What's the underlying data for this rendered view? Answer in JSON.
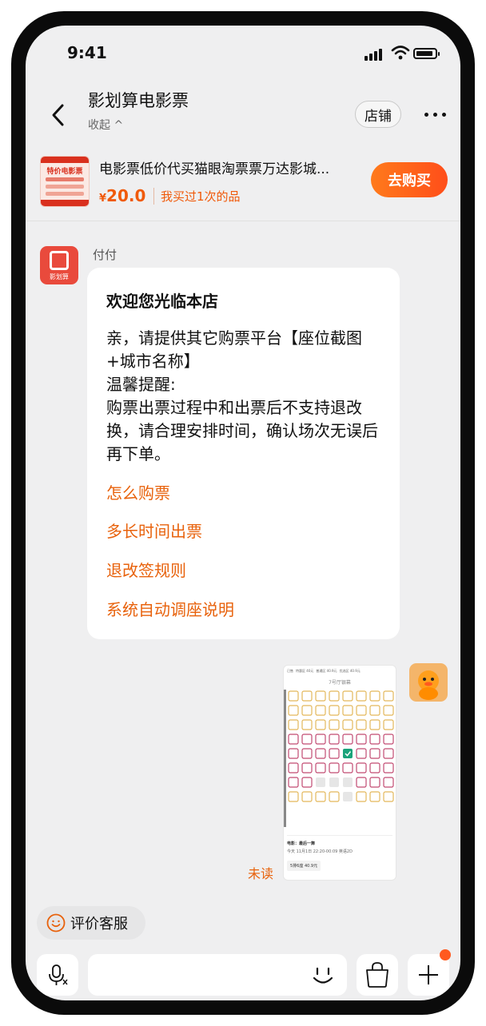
{
  "status_bar": {
    "time": "9:41"
  },
  "header": {
    "shop_name": "影划算电影票",
    "collapse_label": "收起 ^",
    "store_button": "店铺"
  },
  "product": {
    "title": "电影票低价代买猫眼淘票票万达影城...",
    "price_symbol": "¥",
    "price": "20.0",
    "bought_note": "我买过1次的品",
    "buy_button": "去购买",
    "thumb_texts": [
      "特价电影票"
    ]
  },
  "chat": {
    "sender_name": "付付",
    "bot_avatar_text": "影划算",
    "welcome_title": "欢迎您光临本店",
    "welcome_body": "亲，请提供其它购票平台【座位截图+城市名称】\n温馨提醒:\n购票出票过程中和出票后不支持退改换，请合理安排时间，确认场次无误后再下单。",
    "links": [
      "怎么购票",
      "多长时间出票",
      "退改签规则",
      "系统自动调座说明"
    ],
    "unread_label": "未读",
    "seat_image": {
      "hall_name": "7号厅银幕",
      "legend": [
        "已售",
        "特惠区 40元",
        "普通区 40.9元",
        "优选区 40.9元"
      ],
      "movie_line": "电影：最后一舞",
      "time_line": "今天 11月1日 22:20-00:09 英语2D",
      "price_tag": "5排6座 40.9元"
    }
  },
  "bottom": {
    "rate_label": "评价客服",
    "input_placeholder": ""
  },
  "colors": {
    "accent": "#e8620c",
    "buy_button": "#ff5a1f",
    "screen_bg": "#efeff0"
  },
  "icons": [
    "back-arrow-icon",
    "more-dots-icon",
    "smile-icon",
    "voice-icon",
    "emoji-icon",
    "bag-icon",
    "plus-icon"
  ]
}
